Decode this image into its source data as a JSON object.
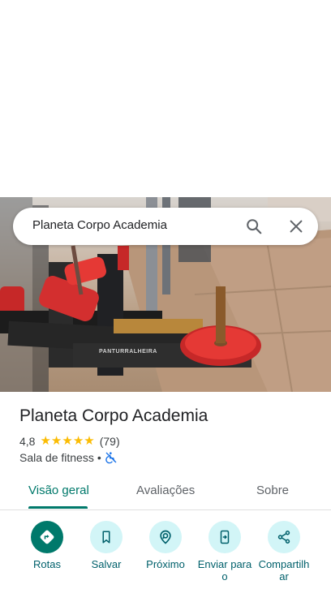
{
  "search": {
    "query": "Planeta Corpo Academia"
  },
  "photo": {
    "equipment_brand_text": "PANTURRALHEIRA"
  },
  "place": {
    "title": "Planeta Corpo Academia",
    "rating": "4,8",
    "stars_filled": 5,
    "review_count": "(79)",
    "category": "Sala de fitness",
    "separator": "•"
  },
  "tabs": [
    {
      "label": "Visão geral",
      "active": true
    },
    {
      "label": "Avaliações",
      "active": false
    },
    {
      "label": "Sobre",
      "active": false
    }
  ],
  "actions": [
    {
      "label": "Rotas",
      "icon": "directions-icon"
    },
    {
      "label": "Salvar",
      "icon": "bookmark-icon"
    },
    {
      "label": "Próximo",
      "icon": "nearby-icon"
    },
    {
      "label": "Enviar para o",
      "icon": "send-to-phone-icon"
    },
    {
      "label": "Compartilhar",
      "icon": "share-icon"
    }
  ],
  "colors": {
    "accent": "#00796b",
    "action_bg": "#d2f5f7",
    "star": "#fbbc04"
  }
}
